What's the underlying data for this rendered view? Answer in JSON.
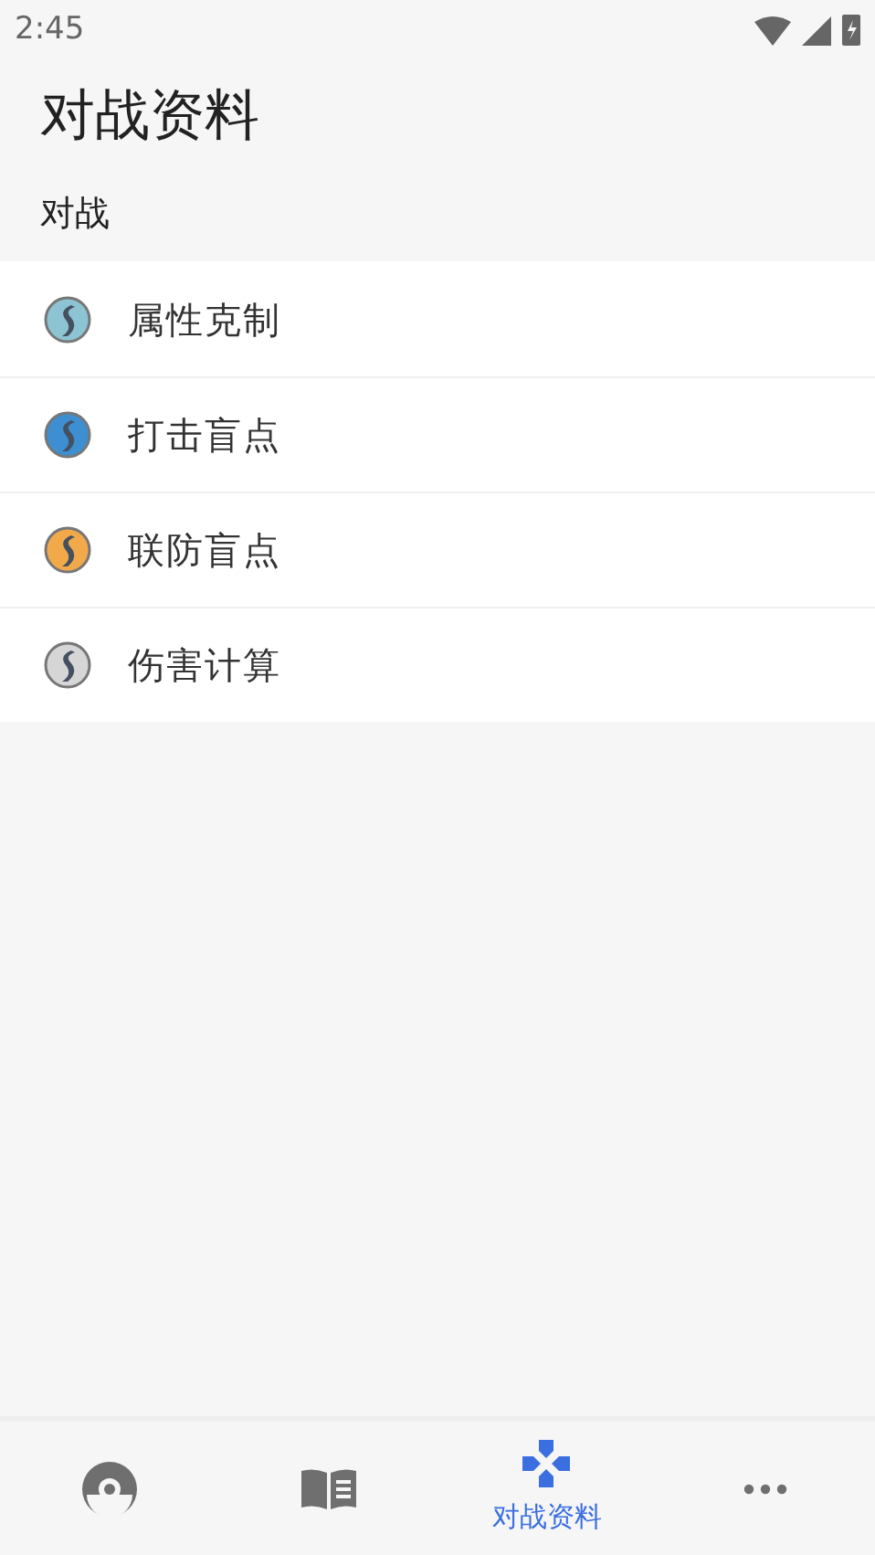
{
  "status_bar": {
    "time": "2:45"
  },
  "title": "对战资料",
  "section": {
    "header": "对战",
    "items": [
      {
        "label": "属性克制",
        "color": "#8cc4d4"
      },
      {
        "label": "打击盲点",
        "color": "#3d8fd1"
      },
      {
        "label": "联防盲点",
        "color": "#f2a94a"
      },
      {
        "label": "伤害计算",
        "color": "#d6d6d6"
      }
    ]
  },
  "bottom_nav": [
    {
      "kind": "ball",
      "selected": false
    },
    {
      "kind": "book",
      "selected": false
    },
    {
      "kind": "gamepad",
      "selected": true,
      "label": "对战资料"
    },
    {
      "kind": "more",
      "selected": false
    }
  ]
}
